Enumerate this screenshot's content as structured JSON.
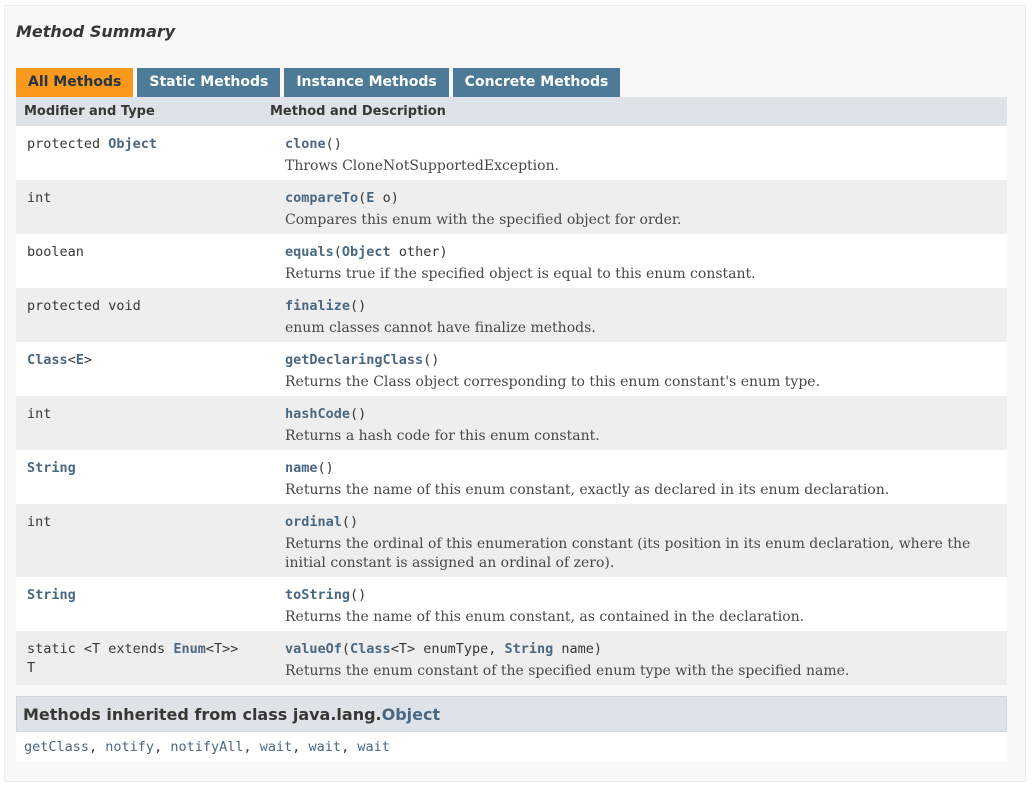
{
  "section_title": "Method Summary",
  "tabs": [
    {
      "label": "All Methods",
      "active": true
    },
    {
      "label": "Static Methods",
      "active": false
    },
    {
      "label": "Instance Methods",
      "active": false
    },
    {
      "label": "Concrete Methods",
      "active": false
    }
  ],
  "table_headers": {
    "modifier": "Modifier and Type",
    "method": "Method and Description"
  },
  "methods": [
    {
      "modifier": [
        [
          {
            "t": "protected "
          },
          {
            "t": "Object",
            "link": true
          }
        ]
      ],
      "signature": [
        {
          "t": "clone",
          "link": true
        },
        {
          "t": "()"
        }
      ],
      "description": "Throws CloneNotSupportedException."
    },
    {
      "modifier": [
        [
          {
            "t": "int"
          }
        ]
      ],
      "signature": [
        {
          "t": "compareTo",
          "link": true
        },
        {
          "t": "("
        },
        {
          "t": "E",
          "link": true
        },
        {
          "t": " o)"
        }
      ],
      "description": "Compares this enum with the specified object for order."
    },
    {
      "modifier": [
        [
          {
            "t": "boolean"
          }
        ]
      ],
      "signature": [
        {
          "t": "equals",
          "link": true
        },
        {
          "t": "("
        },
        {
          "t": "Object",
          "link": true
        },
        {
          "t": " other)"
        }
      ],
      "description": "Returns true if the specified object is equal to this enum constant."
    },
    {
      "modifier": [
        [
          {
            "t": "protected void"
          }
        ]
      ],
      "signature": [
        {
          "t": "finalize",
          "link": true
        },
        {
          "t": "()"
        }
      ],
      "description": "enum classes cannot have finalize methods."
    },
    {
      "modifier": [
        [
          {
            "t": "Class",
            "link": true
          },
          {
            "t": "<"
          },
          {
            "t": "E",
            "link": true
          },
          {
            "t": ">"
          }
        ]
      ],
      "signature": [
        {
          "t": "getDeclaringClass",
          "link": true
        },
        {
          "t": "()"
        }
      ],
      "description": "Returns the Class object corresponding to this enum constant's enum type."
    },
    {
      "modifier": [
        [
          {
            "t": "int"
          }
        ]
      ],
      "signature": [
        {
          "t": "hashCode",
          "link": true
        },
        {
          "t": "()"
        }
      ],
      "description": "Returns a hash code for this enum constant."
    },
    {
      "modifier": [
        [
          {
            "t": "String",
            "link": true
          }
        ]
      ],
      "signature": [
        {
          "t": "name",
          "link": true
        },
        {
          "t": "()"
        }
      ],
      "description": "Returns the name of this enum constant, exactly as declared in its enum declaration."
    },
    {
      "modifier": [
        [
          {
            "t": "int"
          }
        ]
      ],
      "signature": [
        {
          "t": "ordinal",
          "link": true
        },
        {
          "t": "()"
        }
      ],
      "description": "Returns the ordinal of this enumeration constant (its position in its enum declaration, where the initial constant is assigned an ordinal of zero)."
    },
    {
      "modifier": [
        [
          {
            "t": "String",
            "link": true
          }
        ]
      ],
      "signature": [
        {
          "t": "toString",
          "link": true
        },
        {
          "t": "()"
        }
      ],
      "description": "Returns the name of this enum constant, as contained in the declaration."
    },
    {
      "modifier": [
        [
          {
            "t": "static <T extends "
          },
          {
            "t": "Enum",
            "link": true
          },
          {
            "t": "<T>>"
          }
        ],
        [
          {
            "t": "T"
          }
        ]
      ],
      "signature": [
        {
          "t": "valueOf",
          "link": true
        },
        {
          "t": "("
        },
        {
          "t": "Class",
          "link": true
        },
        {
          "t": "<T> enumType, "
        },
        {
          "t": "String",
          "link": true
        },
        {
          "t": " name)"
        }
      ],
      "description": "Returns the enum constant of the specified enum type with the specified name."
    }
  ],
  "inherited": {
    "title_prefix": "Methods inherited from class java.lang.",
    "title_link": "Object",
    "methods": [
      "getClass",
      "notify",
      "notifyAll",
      "wait",
      "wait",
      "wait"
    ],
    "separator": ", "
  },
  "colors": {
    "tab_active": "#f8981d",
    "tab_inactive": "#4d7a97",
    "header_bg": "#dee3e9",
    "row_alt": "#eeeeef",
    "link": "#4a6782"
  }
}
